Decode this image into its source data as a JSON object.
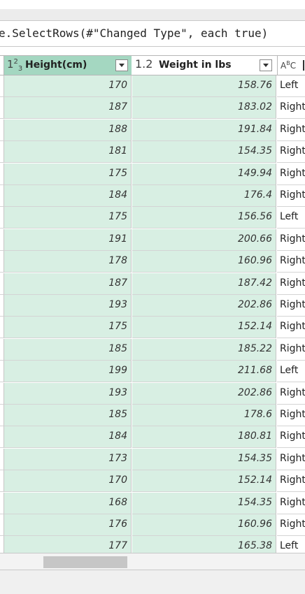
{
  "formula_bar": {
    "text": "e.SelectRows(#\"Changed Type\", each true)"
  },
  "columns": [
    {
      "type_icon": "integer-type-icon",
      "type_text": "1²₃",
      "label": "Height(cm)",
      "selected": true
    },
    {
      "type_icon": "decimal-type-icon",
      "type_text": "1.2",
      "label": "Weight in lbs",
      "selected": false
    },
    {
      "type_icon": "text-type-icon",
      "type_text": "AᴮC",
      "label": "",
      "selected": false
    }
  ],
  "rows": [
    {
      "height": "170",
      "weight": "158.76",
      "side": "Left"
    },
    {
      "height": "187",
      "weight": "183.02",
      "side": "Right"
    },
    {
      "height": "188",
      "weight": "191.84",
      "side": "Right"
    },
    {
      "height": "181",
      "weight": "154.35",
      "side": "Right"
    },
    {
      "height": "175",
      "weight": "149.94",
      "side": "Right"
    },
    {
      "height": "184",
      "weight": "176.4",
      "side": "Right"
    },
    {
      "height": "175",
      "weight": "156.56",
      "side": "Left"
    },
    {
      "height": "191",
      "weight": "200.66",
      "side": "Right"
    },
    {
      "height": "178",
      "weight": "160.96",
      "side": "Right"
    },
    {
      "height": "187",
      "weight": "187.42",
      "side": "Right"
    },
    {
      "height": "193",
      "weight": "202.86",
      "side": "Right"
    },
    {
      "height": "175",
      "weight": "152.14",
      "side": "Right"
    },
    {
      "height": "185",
      "weight": "185.22",
      "side": "Right"
    },
    {
      "height": "199",
      "weight": "211.68",
      "side": "Left"
    },
    {
      "height": "193",
      "weight": "202.86",
      "side": "Right"
    },
    {
      "height": "185",
      "weight": "178.6",
      "side": "Right"
    },
    {
      "height": "184",
      "weight": "180.81",
      "side": "Right"
    },
    {
      "height": "173",
      "weight": "154.35",
      "side": "Right"
    },
    {
      "height": "170",
      "weight": "152.14",
      "side": "Right"
    },
    {
      "height": "168",
      "weight": "154.35",
      "side": "Right"
    },
    {
      "height": "176",
      "weight": "160.96",
      "side": "Right"
    },
    {
      "height": "177",
      "weight": "165.38",
      "side": "Left"
    }
  ],
  "colors": {
    "selected_header": "#a4d7c1",
    "selected_cell": "#d8efe3"
  }
}
